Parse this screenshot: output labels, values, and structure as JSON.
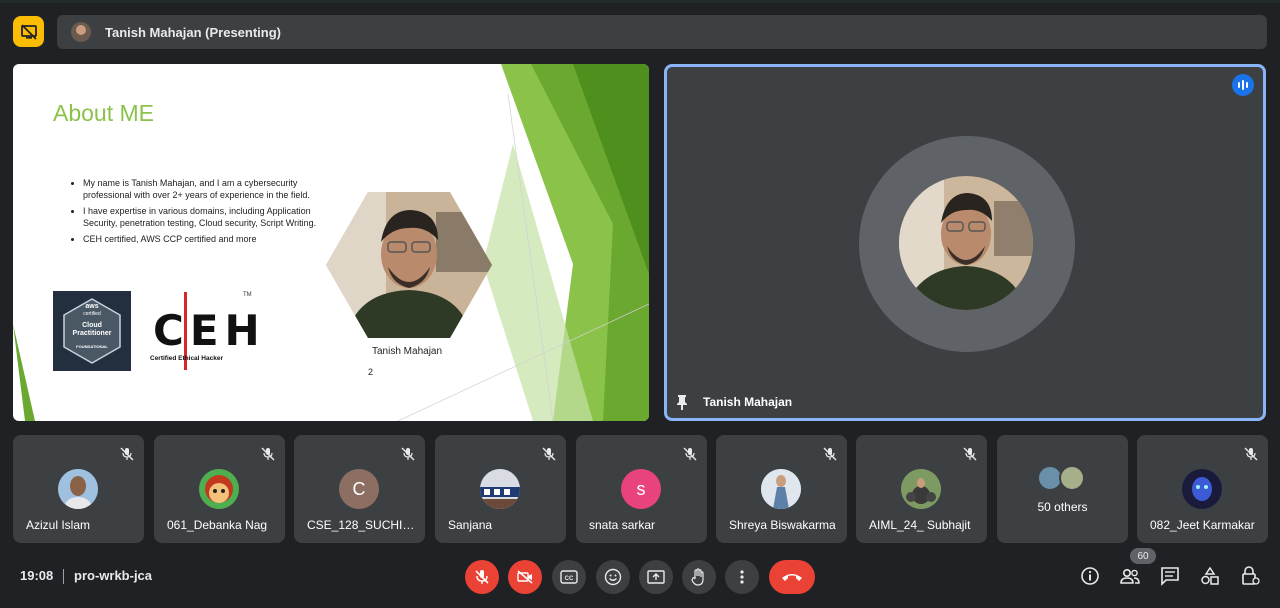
{
  "header": {
    "presenter_label": "Tanish Mahajan (Presenting)"
  },
  "slide": {
    "title": "About ME",
    "bullets": [
      "My name is Tanish Mahajan, and I am a cybersecurity professional with over 2+ years of experience in the field.",
      "I have expertise in various domains, including Application Security, penetration testing, Cloud security, Script Writing.",
      "CEH certified, AWS CCP certified and more"
    ],
    "aws_badge": {
      "line1": "aws",
      "line2": "certified",
      "line3": "Cloud",
      "line4": "Practitioner",
      "line5": "FOUNDATIONAL"
    },
    "ceh_logo": {
      "letters": "CEH",
      "sub": "Certified   Ethical   Hacker",
      "tm": "TM"
    },
    "photo_caption": "Tanish Mahajan",
    "page_number": "2",
    "colors": {
      "title_green": "#8bc34a",
      "accent_green": "#6aa82f"
    }
  },
  "speaker": {
    "name": "Tanish Mahajan",
    "border_color": "#8ab4f8"
  },
  "participants": [
    {
      "name": "Azizul Islam",
      "avatar": "photo",
      "color": "#7aa3c9"
    },
    {
      "name": "061_Debanka Nag",
      "avatar": "photo",
      "color": "#c23a1e"
    },
    {
      "name": "CSE_128_SUCHISMITA ...",
      "avatar": "letter",
      "letter": "C",
      "color": "#8d6e63"
    },
    {
      "name": "Sanjana",
      "avatar": "photo",
      "color": "#4a6fa5"
    },
    {
      "name": "snata sarkar",
      "avatar": "letter",
      "letter": "s",
      "color": "#e8437e"
    },
    {
      "name": "Shreya Biswakarma",
      "avatar": "photo",
      "color": "#b8c4d0"
    },
    {
      "name": "AIML_24_ Subhajit",
      "avatar": "photo",
      "color": "#5c7a4a"
    },
    {
      "name": "50 others",
      "avatar": "group"
    },
    {
      "name": "082_Jeet Karmakar",
      "avatar": "photo",
      "color": "#3b3b7a"
    }
  ],
  "footer": {
    "time": "19:08",
    "meeting_code": "pro-wrkb-jca",
    "people_count": "60"
  },
  "icons": {
    "present": "presentation-off-icon",
    "mic": "mic-off-icon",
    "camera": "camera-off-icon",
    "captions": "captions-icon",
    "emoji": "emoji-icon",
    "present_screen": "present-screen-icon",
    "raise_hand": "raise-hand-icon",
    "more": "more-options-icon",
    "leave": "leave-call-icon",
    "info": "info-icon",
    "people": "people-icon",
    "chat": "chat-icon",
    "activities": "activities-icon",
    "host_controls": "host-controls-icon"
  }
}
